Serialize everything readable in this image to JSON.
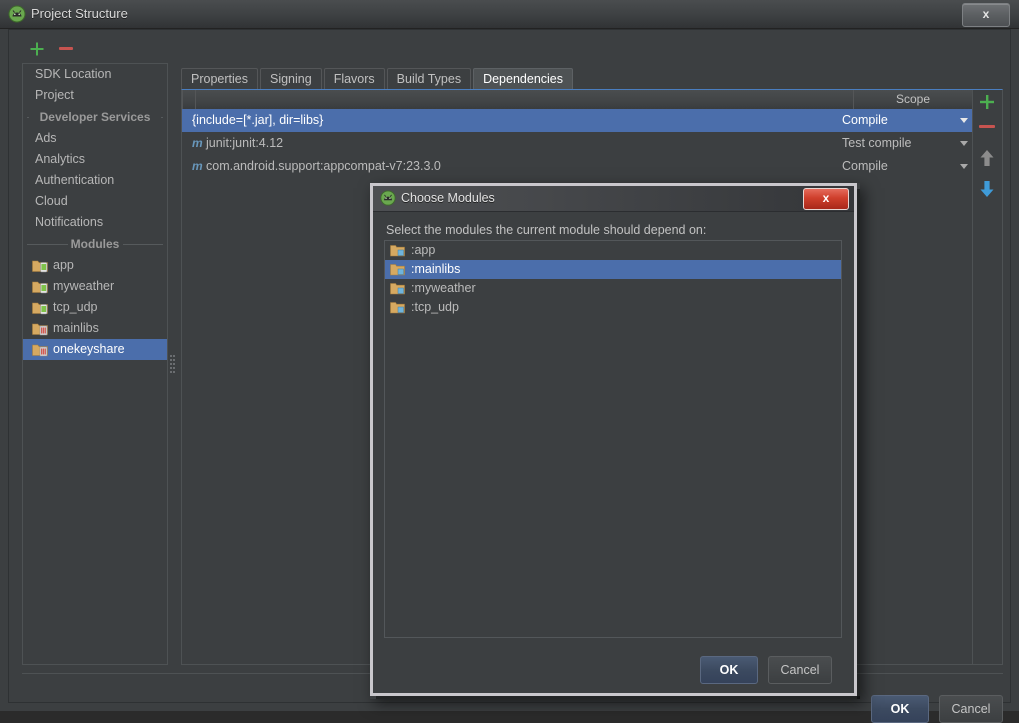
{
  "window": {
    "title": "Project Structure",
    "icon": "android-studio-icon",
    "close_label": "x"
  },
  "toolbar": {
    "add_label": "+",
    "remove_label": "−"
  },
  "sidebar": {
    "items": [
      {
        "label": "SDK Location",
        "type": "item",
        "icon": "",
        "selected": false
      },
      {
        "label": "Project",
        "type": "item",
        "icon": "",
        "selected": false
      },
      {
        "label": "Developer Services",
        "type": "separator",
        "icon": "",
        "selected": false
      },
      {
        "label": "Ads",
        "type": "item",
        "icon": "",
        "selected": false
      },
      {
        "label": "Analytics",
        "type": "item",
        "icon": "",
        "selected": false
      },
      {
        "label": "Authentication",
        "type": "item",
        "icon": "",
        "selected": false
      },
      {
        "label": "Cloud",
        "type": "item",
        "icon": "",
        "selected": false
      },
      {
        "label": "Notifications",
        "type": "item",
        "icon": "",
        "selected": false
      },
      {
        "label": "Modules",
        "type": "separator",
        "icon": "",
        "selected": false
      },
      {
        "label": "app",
        "type": "module",
        "icon": "android-module-icon",
        "selected": false
      },
      {
        "label": "myweather",
        "type": "module",
        "icon": "android-module-icon",
        "selected": false
      },
      {
        "label": "tcp_udp",
        "type": "module",
        "icon": "android-module-icon",
        "selected": false
      },
      {
        "label": "mainlibs",
        "type": "module",
        "icon": "android-library-icon",
        "selected": false
      },
      {
        "label": "onekeyshare",
        "type": "module",
        "icon": "android-library-icon",
        "selected": true
      }
    ]
  },
  "tabs": [
    {
      "label": "Properties",
      "active": false
    },
    {
      "label": "Signing",
      "active": false
    },
    {
      "label": "Flavors",
      "active": false
    },
    {
      "label": "Build Types",
      "active": false
    },
    {
      "label": "Dependencies",
      "active": true
    }
  ],
  "dependencies_table": {
    "columns": [
      "",
      "Scope"
    ],
    "rows": [
      {
        "icon": "",
        "name": "{include=[*.jar], dir=libs}",
        "scope": "Compile",
        "selected": true
      },
      {
        "icon": "m",
        "name": "junit:junit:4.12",
        "scope": "Test compile",
        "selected": false
      },
      {
        "icon": "m",
        "name": "com.android.support:appcompat-v7:23.3.0",
        "scope": "Compile",
        "selected": false
      }
    ]
  },
  "side_buttons": [
    {
      "name": "add-dependency-button",
      "icon": "plus-icon",
      "color": "#4caf50"
    },
    {
      "name": "remove-dependency-button",
      "icon": "minus-icon",
      "color": "#c75450"
    },
    {
      "name": "move-up-button",
      "icon": "arrow-up-icon",
      "color": "#8c8c8c"
    },
    {
      "name": "move-down-button",
      "icon": "arrow-down-icon",
      "color": "#3f9bd8"
    }
  ],
  "footer": {
    "ok_label": "OK",
    "cancel_label": "Cancel"
  },
  "dialog": {
    "title": "Choose Modules",
    "icon": "android-studio-icon",
    "close_label": "x",
    "prompt": "Select the modules the current module should depend on:",
    "modules": [
      {
        "label": ":app",
        "icon": "module-folder-icon",
        "selected": false
      },
      {
        "label": ":mainlibs",
        "icon": "module-folder-icon",
        "selected": true
      },
      {
        "label": ":myweather",
        "icon": "module-folder-icon",
        "selected": false
      },
      {
        "label": ":tcp_udp",
        "icon": "module-folder-icon",
        "selected": false
      }
    ],
    "ok_label": "OK",
    "cancel_label": "Cancel"
  },
  "colors": {
    "selection_blue": "#4b6eab",
    "accent_tab": "#4a7ec0",
    "add_green": "#4caf50",
    "remove_red": "#c75450",
    "close_red": "#cf3f2c",
    "background": "#3c3f41"
  }
}
